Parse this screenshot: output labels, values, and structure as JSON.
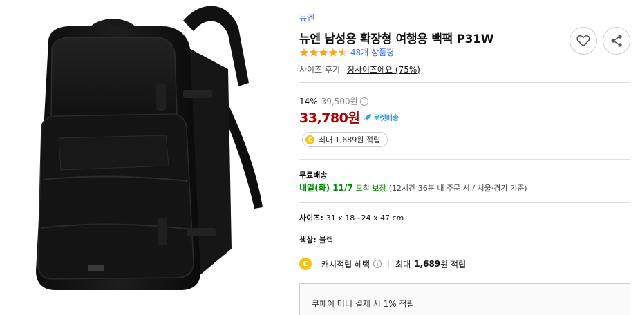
{
  "product": {
    "brand": "뉴엔",
    "title": "뉴엔 남성용 확장형 여행용 백팩 P31W",
    "rating": 4.5,
    "rating_max": 5,
    "review_count_text": "48개 상품평",
    "size_review_label": "사이즈 후기",
    "size_review_link": "정사이즈에요",
    "size_review_percent": "(75%)"
  },
  "price": {
    "discount_rate": "14%",
    "original_price": "39,500원",
    "sale_price": "33,780원",
    "delivery_badge": "로켓배송",
    "reward_text": "최대 1,689원 적립"
  },
  "shipping": {
    "label": "무료배송",
    "date": "내일(화) 11/7",
    "guarantee": "도착 보장",
    "note": "(12시간 36분  내 주문 시 / 서울⋅경기 기준)"
  },
  "options": {
    "size_label": "사이즈:",
    "size_value": "31 x 18~24 x 47 cm",
    "color_label": "색상:",
    "color_value": "블랙"
  },
  "cash": {
    "label": "캐시적립 혜택",
    "max_label": "최대",
    "amount": "1,689",
    "suffix": "원 적립"
  },
  "payment": {
    "text": "쿠페이 머니 결제 시 1% 적립"
  },
  "icons": {
    "coin_letter": "C",
    "info_letter": "i"
  },
  "colors": {
    "link_blue": "#346aff",
    "sale_red": "#ae0000",
    "ship_green": "#008c00",
    "star_orange": "#f5a623",
    "coin_yellow": "#f7c21a",
    "rocket_blue": "#33a0d5"
  }
}
